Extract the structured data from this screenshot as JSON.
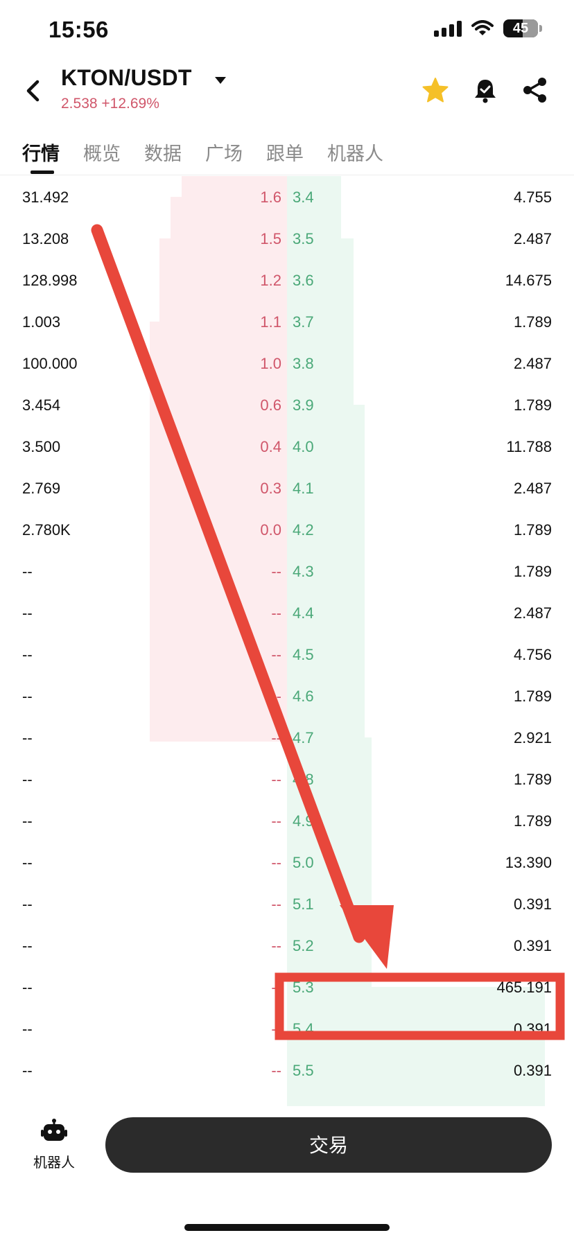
{
  "status": {
    "time": "15:56",
    "battery": "45"
  },
  "header": {
    "pair": "KTON/USDT",
    "price_change": "2.538 +12.69%"
  },
  "tabs": [
    "行情",
    "概览",
    "数据",
    "广场",
    "跟单",
    "机器人"
  ],
  "order_book": {
    "rows": [
      {
        "sell_qty": "31.492",
        "sell_price": "1.6",
        "buy_price": "3.4",
        "buy_amount": "4.755"
      },
      {
        "sell_qty": "13.208",
        "sell_price": "1.5",
        "buy_price": "3.5",
        "buy_amount": "2.487"
      },
      {
        "sell_qty": "128.998",
        "sell_price": "1.2",
        "buy_price": "3.6",
        "buy_amount": "14.675"
      },
      {
        "sell_qty": "1.003",
        "sell_price": "1.1",
        "buy_price": "3.7",
        "buy_amount": "1.789"
      },
      {
        "sell_qty": "100.000",
        "sell_price": "1.0",
        "buy_price": "3.8",
        "buy_amount": "2.487"
      },
      {
        "sell_qty": "3.454",
        "sell_price": "0.6",
        "buy_price": "3.9",
        "buy_amount": "1.789"
      },
      {
        "sell_qty": "3.500",
        "sell_price": "0.4",
        "buy_price": "4.0",
        "buy_amount": "11.788"
      },
      {
        "sell_qty": "2.769",
        "sell_price": "0.3",
        "buy_price": "4.1",
        "buy_amount": "2.487"
      },
      {
        "sell_qty": "2.780K",
        "sell_price": "0.0",
        "buy_price": "4.2",
        "buy_amount": "1.789"
      },
      {
        "sell_qty": "--",
        "sell_price": "--",
        "buy_price": "4.3",
        "buy_amount": "1.789"
      },
      {
        "sell_qty": "--",
        "sell_price": "--",
        "buy_price": "4.4",
        "buy_amount": "2.487"
      },
      {
        "sell_qty": "--",
        "sell_price": "--",
        "buy_price": "4.5",
        "buy_amount": "4.756"
      },
      {
        "sell_qty": "--",
        "sell_price": "--",
        "buy_price": "4.6",
        "buy_amount": "1.789"
      },
      {
        "sell_qty": "--",
        "sell_price": "--",
        "buy_price": "4.7",
        "buy_amount": "2.921"
      },
      {
        "sell_qty": "--",
        "sell_price": "--",
        "buy_price": "4.8",
        "buy_amount": "1.789"
      },
      {
        "sell_qty": "--",
        "sell_price": "--",
        "buy_price": "4.9",
        "buy_amount": "1.789"
      },
      {
        "sell_qty": "--",
        "sell_price": "--",
        "buy_price": "5.0",
        "buy_amount": "13.390"
      },
      {
        "sell_qty": "--",
        "sell_price": "--",
        "buy_price": "5.1",
        "buy_amount": "0.391"
      },
      {
        "sell_qty": "--",
        "sell_price": "--",
        "buy_price": "5.2",
        "buy_amount": "0.391"
      },
      {
        "sell_qty": "--",
        "sell_price": "--",
        "buy_price": "5.3",
        "buy_amount": "465.191"
      },
      {
        "sell_qty": "--",
        "sell_price": "--",
        "buy_price": "5.4",
        "buy_amount": "0.391"
      },
      {
        "sell_qty": "--",
        "sell_price": "--",
        "buy_price": "5.5",
        "buy_amount": "0.391"
      }
    ]
  },
  "bottom": {
    "robot_label": "机器人",
    "trade_label": "交易"
  },
  "colors": {
    "sell": "#d0566a",
    "buy": "#4aa878",
    "annotation": "#e8473b",
    "star": "#f5c028"
  },
  "icons": [
    "signal-icon",
    "wifi-icon",
    "battery-icon",
    "back-arrow-icon",
    "caret-down-icon",
    "star-icon",
    "bell-icon",
    "share-icon",
    "robot-icon"
  ]
}
